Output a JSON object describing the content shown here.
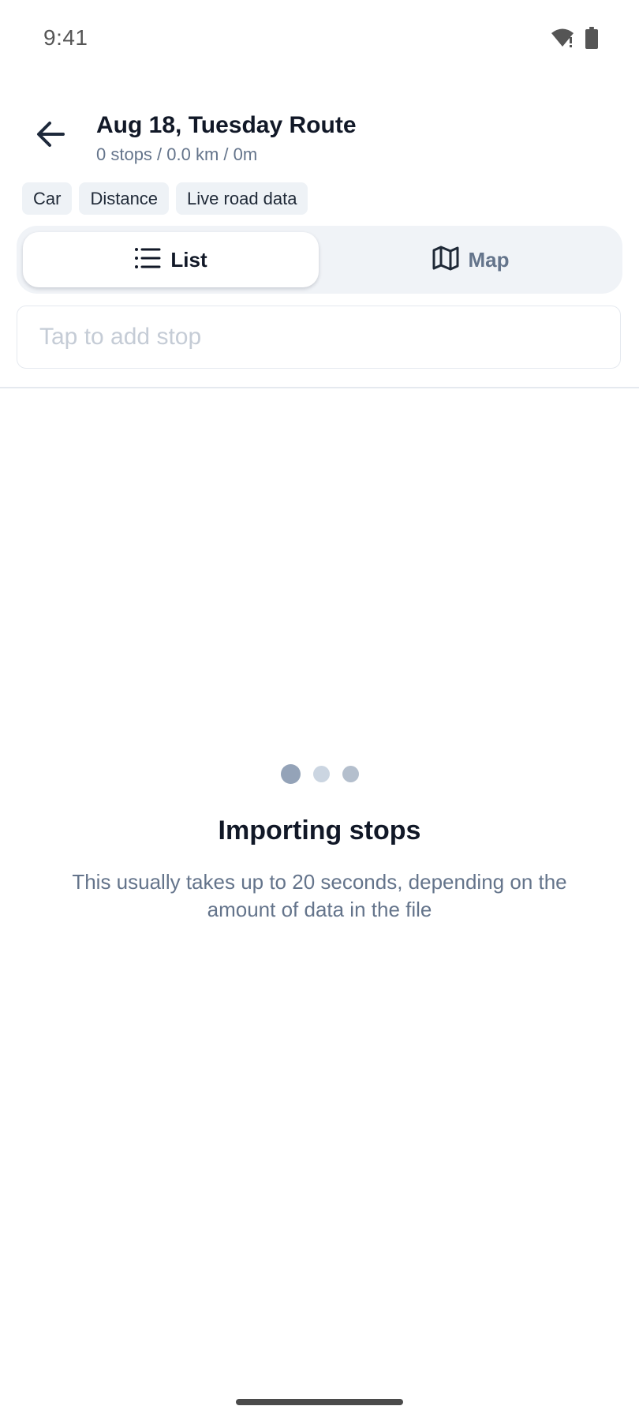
{
  "status_bar": {
    "time": "9:41",
    "wifi_icon": "wifi-alert-icon",
    "battery_icon": "battery-icon"
  },
  "header": {
    "back_icon": "arrow-left-icon",
    "title": "Aug 18, Tuesday Route",
    "subtitle": "0 stops / 0.0 km / 0m"
  },
  "chips": [
    "Car",
    "Distance",
    "Live road data"
  ],
  "view_toggle": {
    "selected": "List",
    "list": {
      "label": "List",
      "icon": "list-icon"
    },
    "map": {
      "label": "Map",
      "icon": "map-icon"
    }
  },
  "add_stop": {
    "placeholder": "Tap to add stop"
  },
  "loading": {
    "title": "Importing stops",
    "description": "This usually takes up to 20 seconds, depending on the amount of data in the file"
  },
  "colors": {
    "text_primary": "#111827",
    "text_secondary": "#64748b",
    "chip_bg": "#eef2f6",
    "toggle_bg": "#f0f3f7",
    "placeholder": "#c5ccd6",
    "dot_active": "#94a3b8",
    "dot_inactive": "#cbd5e1"
  }
}
